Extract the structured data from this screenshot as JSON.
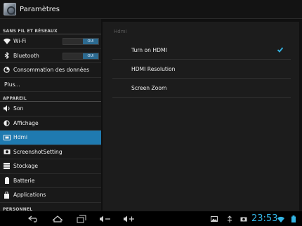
{
  "app": {
    "title": "Paramètres",
    "icon": "settings-app-icon"
  },
  "sidebar": {
    "categories": [
      "SANS FIL ET RÉSEAUX",
      "APPAREIL",
      "PERSONNEL"
    ],
    "items": [
      {
        "label": "Wi-Fi",
        "icon": "wifi-icon",
        "toggle": "OUI"
      },
      {
        "label": "Bluetooth",
        "icon": "bluetooth-icon",
        "toggle": "OUI"
      },
      {
        "label": "Consommation des données",
        "icon": "data-usage-icon"
      },
      {
        "label": "Plus..."
      },
      {
        "label": "Son",
        "icon": "sound-icon"
      },
      {
        "label": "Affichage",
        "icon": "display-icon"
      },
      {
        "label": "Hdmi",
        "icon": "hdmi-icon",
        "selected": true
      },
      {
        "label": "ScreenshotSetting",
        "icon": "screenshot-icon"
      },
      {
        "label": "Stockage",
        "icon": "storage-icon"
      },
      {
        "label": "Batterie",
        "icon": "battery-icon"
      },
      {
        "label": "Applications",
        "icon": "applications-icon"
      }
    ]
  },
  "detail": {
    "section_title": "Hdmi",
    "options": [
      {
        "label": "Turn on HDMI",
        "checked": true
      },
      {
        "label": "HDMI Resolution"
      },
      {
        "label": "Screen Zoom"
      }
    ]
  },
  "navbar": {
    "time": "23:53",
    "accent_color": "#33b5e5",
    "buttons": [
      "back-icon",
      "home-icon",
      "recent-apps-icon",
      "volume-down-icon",
      "volume-up-icon"
    ],
    "status_icons": [
      "image-icon",
      "usb-icon",
      "camera-icon",
      "wifi-signal-icon",
      "battery-status-icon"
    ]
  }
}
